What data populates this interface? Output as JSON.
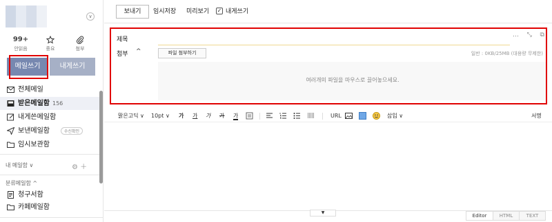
{
  "sidebar": {
    "quick": [
      {
        "top": "99+",
        "label": "안읽음",
        "icon": "unread-count"
      },
      {
        "top": "",
        "label": "중요",
        "icon": "star-icon"
      },
      {
        "top": "",
        "label": "첨부",
        "icon": "paperclip-icon"
      }
    ],
    "compose_label": "메일쓰기",
    "self_label": "내게쓰기",
    "folders": [
      {
        "label": "전체메일",
        "icon": "mail-icon"
      },
      {
        "label": "받은메일함",
        "count": "156",
        "icon": "inbox-icon",
        "active": true
      },
      {
        "label": "내게쓴메일함",
        "icon": "self-note-icon"
      },
      {
        "label": "보낸메일함",
        "badge": "수신확인",
        "icon": "send-icon"
      },
      {
        "label": "임시보관함",
        "icon": "folder-icon"
      }
    ],
    "my_mailbox": "내 메일함 ∨",
    "category": "분류메일함 ^",
    "category_items": [
      {
        "label": "청구서함",
        "icon": "bill-icon"
      },
      {
        "label": "카페메일함",
        "icon": "folder-icon"
      }
    ]
  },
  "toolbar": {
    "send_label": "보내기",
    "save_label": "임시저장",
    "preview_label": "미리보기",
    "self_label": "내게쓰기"
  },
  "compose": {
    "subject_label": "제목",
    "subject_value": "",
    "attach_label": "첨부",
    "attach_button": "파일 첨부하기",
    "attach_info": "일반 : 0KB/25MB (대용량 무제한)",
    "dropzone_text": "여러개의 파일을 마우스로 끌어놓으세요."
  },
  "format": {
    "font": "맑은고딕",
    "size": "10pt",
    "bold": "가",
    "underline": "가",
    "italic": "가",
    "strike": "가",
    "color": "가",
    "url": "URL",
    "insert": "삽입",
    "signature": "서명"
  },
  "modes": [
    "Editor",
    "HTML",
    "TEXT"
  ],
  "colors": {
    "compose_button": "#7788b0",
    "highlight": "#e00000"
  }
}
